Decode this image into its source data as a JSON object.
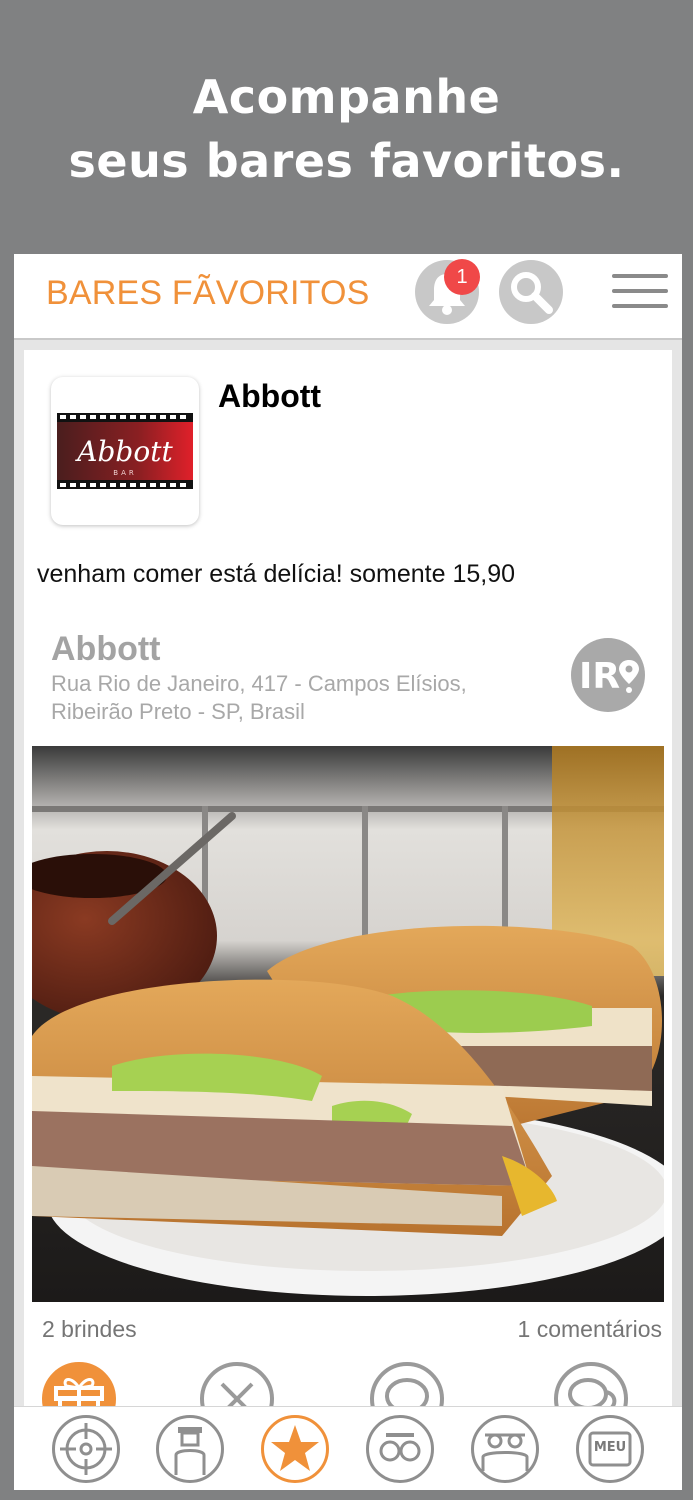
{
  "promo": {
    "line1": "Acompanhe",
    "line2": "seus bares favoritos."
  },
  "header": {
    "title": "BARES FÃVORITOS",
    "notification_count": "1",
    "icons": [
      "bell-icon",
      "search-icon",
      "hamburger-menu-icon"
    ]
  },
  "post": {
    "bar_name": "Abbott",
    "logo_text": "Abbott",
    "logo_subtext": "BAR",
    "text": "venham comer está delícia! somente 15,90",
    "location": {
      "name": "Abbott",
      "address": "Rua Rio de Janeiro, 417 - Campos Elísios, Ribeirão Preto - SP, Brasil",
      "go_label": "IR"
    },
    "photo": "sandwich-photo",
    "toasts": "2 brindes",
    "comments": "1 comentários",
    "actions": [
      "gift-icon",
      "close-icon",
      "comment-icon",
      "chat-icon"
    ]
  },
  "bottom_nav": {
    "items": [
      "target-icon",
      "person-icon",
      "star-icon",
      "glasses-icon",
      "friends-icon",
      "meu-icon"
    ],
    "meu_label": "MEU",
    "active": "star-icon"
  },
  "colors": {
    "accent": "#f0913a",
    "badge": "#f04848",
    "background": "#808182"
  }
}
